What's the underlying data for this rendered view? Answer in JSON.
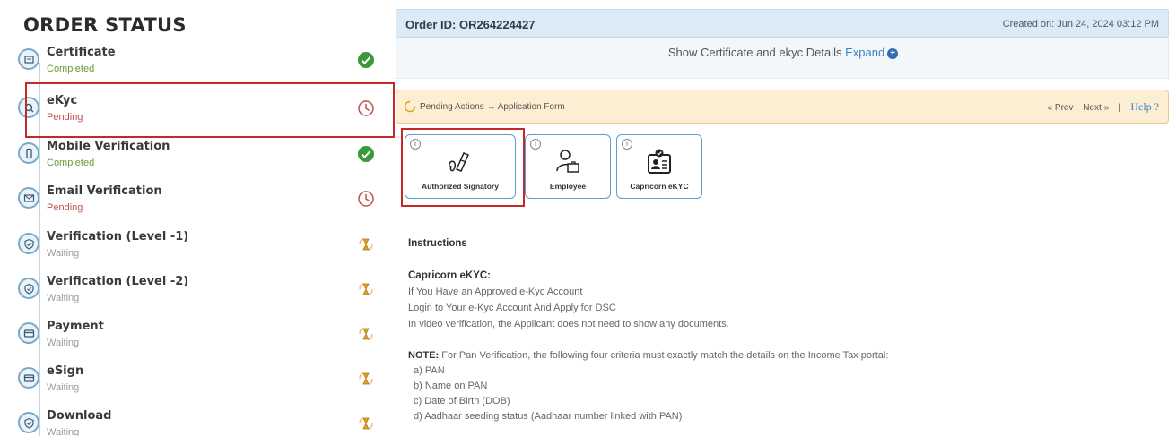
{
  "left": {
    "title": "ORDER STATUS",
    "steps": [
      {
        "name": "Certificate",
        "status": "Completed",
        "state": "completed",
        "icon": "certificate-icon"
      },
      {
        "name": "eKyc",
        "status": "Pending",
        "state": "pending",
        "icon": "search-icon"
      },
      {
        "name": "Mobile Verification",
        "status": "Completed",
        "state": "completed",
        "icon": "mobile-icon"
      },
      {
        "name": "Email Verification",
        "status": "Pending",
        "state": "pending",
        "icon": "mail-icon"
      },
      {
        "name": "Verification (Level -1)",
        "status": "Waiting",
        "state": "waiting",
        "icon": "shield-icon"
      },
      {
        "name": "Verification (Level -2)",
        "status": "Waiting",
        "state": "waiting",
        "icon": "shield-icon"
      },
      {
        "name": "Payment",
        "status": "Waiting",
        "state": "waiting",
        "icon": "card-icon"
      },
      {
        "name": "eSign",
        "status": "Waiting",
        "state": "waiting",
        "icon": "card-icon"
      },
      {
        "name": "Download",
        "status": "Waiting",
        "state": "waiting",
        "icon": "shield-icon"
      }
    ]
  },
  "header": {
    "order_id": "Order ID: OR264224427",
    "created": "Created on: Jun 24, 2024 03:12 PM",
    "expand_text": "Show Certificate and ekyc Details ",
    "expand_link": "Expand"
  },
  "action_bar": {
    "breadcrumb": "Pending Actions → Application Form",
    "prev": "« Prev",
    "next": "Next »",
    "separator": "|",
    "help": "Help ?"
  },
  "cards": [
    {
      "label": "Authorized Signatory",
      "icon": "signature-icon"
    },
    {
      "label": "Employee",
      "icon": "employee-icon"
    },
    {
      "label": "Capricorn eKYC",
      "icon": "id-card-icon"
    }
  ],
  "instructions": {
    "heading": "Instructions",
    "sub_heading": "Capricorn eKYC:",
    "lines": [
      "If You Have an Approved e-Kyc Account",
      "Login to Your e-Kyc Account And Apply for DSC",
      "In video verification, the Applicant does not need to show any documents."
    ],
    "note_label": "NOTE:",
    "note_text": " For Pan Verification, the following four criteria must exactly match the details on the Income Tax portal:",
    "criteria": [
      "a) PAN",
      "b) Name on PAN",
      "c) Date of Birth (DOB)",
      "d) Aadhaar seeding status (Aadhaar number linked with PAN)"
    ]
  },
  "colors": {
    "completed": "#3a9a3a",
    "pending": "#c0504d",
    "waiting": "#e0a020",
    "highlight": "#c62828",
    "accent": "#3b82c4"
  }
}
